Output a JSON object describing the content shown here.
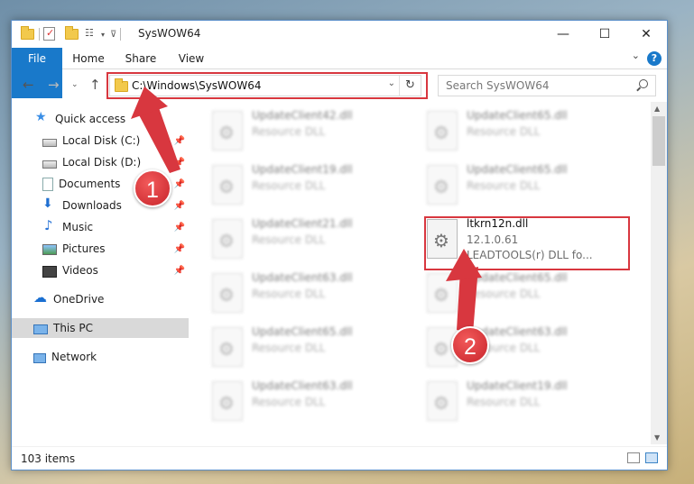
{
  "window": {
    "title": "SysWOW64"
  },
  "ribbon": {
    "tabs": [
      "File",
      "Home",
      "Share",
      "View"
    ],
    "help": "?"
  },
  "address": {
    "path": "C:\\Windows\\SysWOW64"
  },
  "search": {
    "placeholder": "Search SysWOW64"
  },
  "sidebar": {
    "items": [
      {
        "label": "Quick access",
        "icon": "star-icon"
      },
      {
        "label": "Local Disk (C:)",
        "icon": "drive-icon",
        "pinned": true
      },
      {
        "label": "Local Disk (D:)",
        "icon": "drive-icon",
        "pinned": true
      },
      {
        "label": "Documents",
        "icon": "documents-icon",
        "pinned": true
      },
      {
        "label": "Downloads",
        "icon": "downloads-icon",
        "pinned": true
      },
      {
        "label": "Music",
        "icon": "music-icon",
        "pinned": true
      },
      {
        "label": "Pictures",
        "icon": "pictures-icon",
        "pinned": true
      },
      {
        "label": "Videos",
        "icon": "videos-icon",
        "pinned": true
      },
      {
        "label": "OneDrive",
        "icon": "cloud-icon"
      },
      {
        "label": "This PC",
        "icon": "pc-icon",
        "selected": true
      },
      {
        "label": "Network",
        "icon": "network-icon"
      }
    ]
  },
  "files": {
    "left": [
      {
        "name": "UpdateClient42.dll",
        "type": "Resource DLL"
      },
      {
        "name": "UpdateClient19.dll",
        "type": "Resource DLL"
      },
      {
        "name": "UpdateClient21.dll",
        "type": "Resource DLL"
      },
      {
        "name": "UpdateClient63.dll",
        "type": "Resource DLL"
      },
      {
        "name": "UpdateClient65.dll",
        "type": "Resource DLL"
      },
      {
        "name": "UpdateClient63.dll",
        "type": "Resource DLL"
      }
    ],
    "right": [
      {
        "name": "UpdateClient65.dll",
        "type": "Resource DLL"
      },
      {
        "name": "UpdateClient65.dll",
        "type": "Resource DLL"
      },
      {
        "name": "ltkrn12n.dll",
        "version": "12.1.0.61",
        "desc": "LEADTOOLS(r) DLL fo..."
      },
      {
        "name": "UpdateClient65.dll",
        "type": "Resource DLL"
      },
      {
        "name": "UpdateClient63.dll",
        "type": "Resource DLL"
      },
      {
        "name": "UpdateClient19.dll",
        "type": "Resource DLL"
      }
    ]
  },
  "status": {
    "count": "103 items"
  },
  "callouts": {
    "one": "1",
    "two": "2"
  },
  "colors": {
    "accent": "#1979ca",
    "highlight": "#d8373f"
  }
}
